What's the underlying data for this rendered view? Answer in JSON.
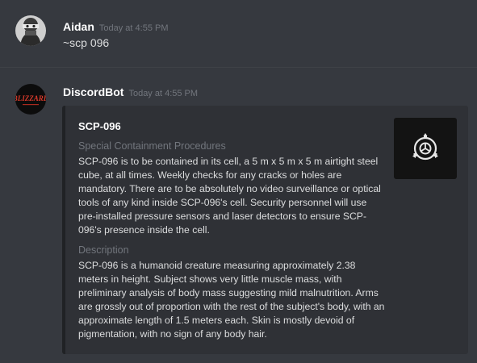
{
  "messages": [
    {
      "author": "Aidan",
      "timestamp": "Today at 4:55 PM",
      "text": "~scp 096",
      "avatar_icon": "masked-face-avatar"
    },
    {
      "author": "DiscordBot",
      "timestamp": "Today at 4:55 PM",
      "avatar_icon": "blizzard-logo-avatar",
      "avatar_text": "BLIZZARD",
      "embed": {
        "title": "SCP-096",
        "thumbnail_icon": "scp-foundation-logo-icon",
        "fields": [
          {
            "name": "Special Containment Procedures",
            "value": "SCP-096 is to be contained in its cell, a 5 m x 5 m x 5 m airtight steel cube, at all times. Weekly checks for any cracks or holes are mandatory. There are to be absolutely no video surveillance or optical tools of any kind inside SCP-096's cell. Security personnel will use pre-installed pressure sensors and laser detectors to ensure SCP-096's presence inside the cell."
          },
          {
            "name": "Description",
            "value": "SCP-096 is a humanoid creature measuring approximately 2.38 meters in height. Subject shows very little muscle mass, with preliminary analysis of body mass suggesting mild malnutrition. Arms are grossly out of proportion with the rest of the subject's body, with an approximate length of 1.5 meters each. Skin is mostly devoid of pigmentation, with no sign of any body hair."
          }
        ]
      }
    }
  ],
  "colors": {
    "background": "#36393f",
    "embed_background": "#2f3136",
    "embed_border": "#202225",
    "username": "#ffffff",
    "timestamp": "#72767d",
    "text": "#dcddde"
  }
}
